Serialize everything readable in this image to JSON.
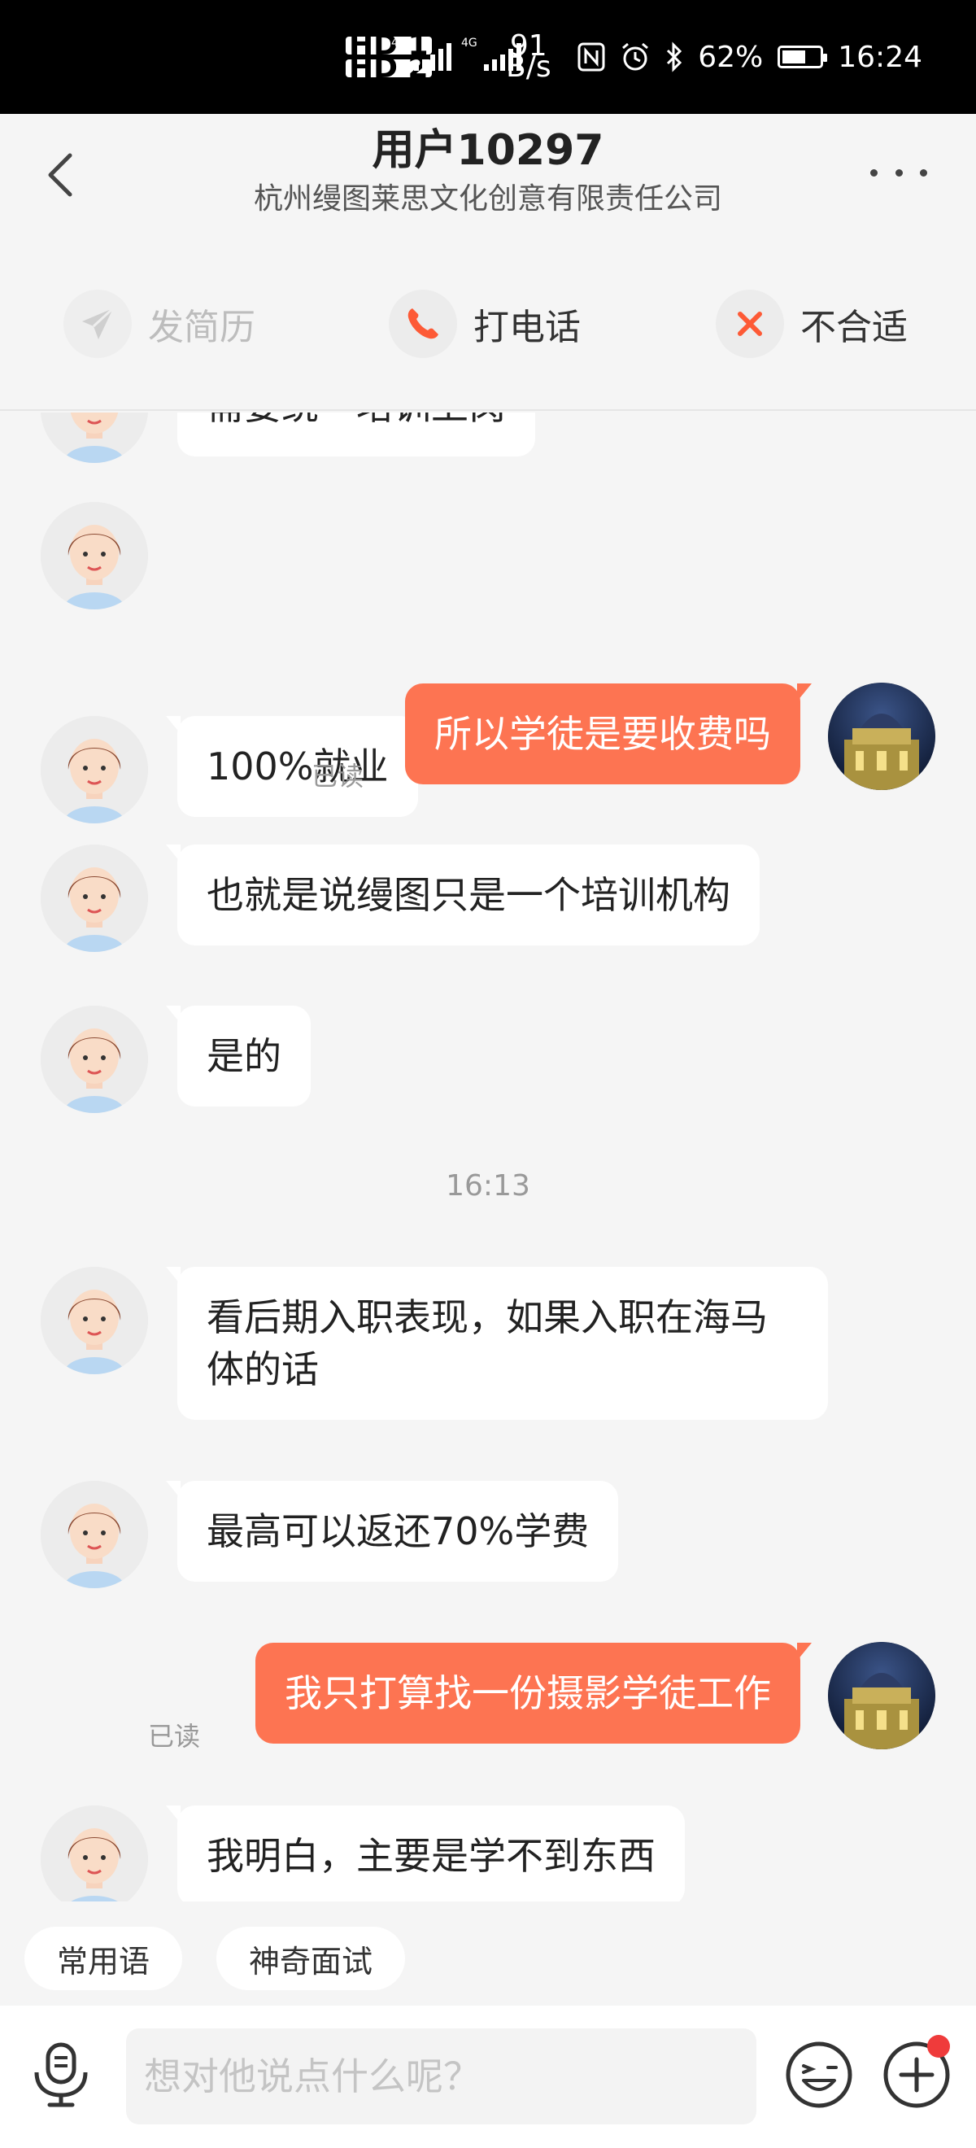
{
  "status_bar": {
    "hd1": "HD 1",
    "hd2": "HD 2",
    "net1": "4G",
    "net2": "4G",
    "speed_value": "91",
    "speed_unit": "B/s",
    "battery": "62%",
    "battery_level": 0.62,
    "time": "16:24",
    "icons": [
      "nfc-icon",
      "alarm-icon",
      "bluetooth-icon",
      "battery-icon"
    ]
  },
  "header": {
    "title": "用户10297",
    "subtitle": "杭州缦图莱思文化创意有限责任公司"
  },
  "actions": [
    {
      "label": "发简历",
      "icon": "send-icon",
      "enabled": false
    },
    {
      "label": "打电话",
      "icon": "phone-icon",
      "enabled": true
    },
    {
      "label": "不合适",
      "icon": "close-icon",
      "enabled": true
    }
  ],
  "messages": [
    {
      "from": "them",
      "text": "需要统一培训上岗"
    },
    {
      "from": "them",
      "text": "100%就业"
    },
    {
      "from": "me",
      "text": "所以学徒是要收费吗",
      "status": "已读"
    },
    {
      "from": "them",
      "text": "也就是说缦图只是一个培训机构"
    },
    {
      "from": "them",
      "text": "是的"
    },
    {
      "from": "system",
      "text": "16:13"
    },
    {
      "from": "them",
      "text": "看后期入职表现，如果入职在海马体的话"
    },
    {
      "from": "them",
      "text": "最高可以返还70%学费"
    },
    {
      "from": "me",
      "text": "我只打算找一份摄影学徒工作",
      "status": "已读"
    },
    {
      "from": "them",
      "text": "我明白，主要是学不到东西"
    }
  ],
  "quick_phrases": [
    "常用语",
    "神奇面试"
  ],
  "input": {
    "placeholder": "想对他说点什么呢？",
    "value": ""
  },
  "colors": {
    "accent": "#fd7452",
    "background": "#f5f5f5",
    "badge": "#ef3b3b"
  }
}
